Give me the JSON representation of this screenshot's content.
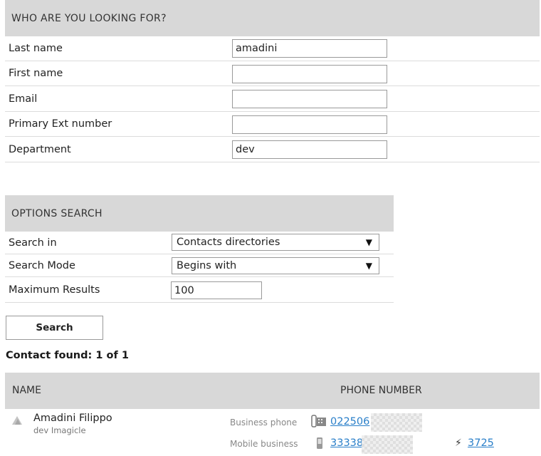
{
  "who_section": {
    "title": "WHO ARE YOU LOOKING FOR?",
    "fields": [
      {
        "label": "Last name",
        "value": "amadini"
      },
      {
        "label": "First name",
        "value": ""
      },
      {
        "label": "Email",
        "value": ""
      },
      {
        "label": "Primary Ext number",
        "value": ""
      },
      {
        "label": "Department",
        "value": "dev"
      }
    ]
  },
  "options_section": {
    "title": "OPTIONS SEARCH",
    "search_in": {
      "label": "Search in",
      "selected": "Contacts directories"
    },
    "search_mode": {
      "label": "Search Mode",
      "selected": "Begins with"
    },
    "max_results": {
      "label": "Maximum Results",
      "value": "100"
    }
  },
  "search_button": {
    "label": "Search"
  },
  "results": {
    "summary": "Contact found: 1 of 1",
    "columns": {
      "name": "NAME",
      "phone": "PHONE NUMBER"
    },
    "contact": {
      "name": "Amadini Filippo",
      "subtitle": "dev Imagicle",
      "phones": [
        {
          "label": "Business phone",
          "number": "022506",
          "icon": "desk-phone-icon"
        },
        {
          "label": "Mobile business",
          "number": "33338",
          "icon": "mobile-phone-icon"
        }
      ],
      "extension": {
        "number": "3725",
        "icon": "lightning-icon"
      }
    }
  },
  "colors": {
    "header_bg": "#d8d8d8",
    "link": "#2a7fc9",
    "border": "#9a9a9a"
  }
}
